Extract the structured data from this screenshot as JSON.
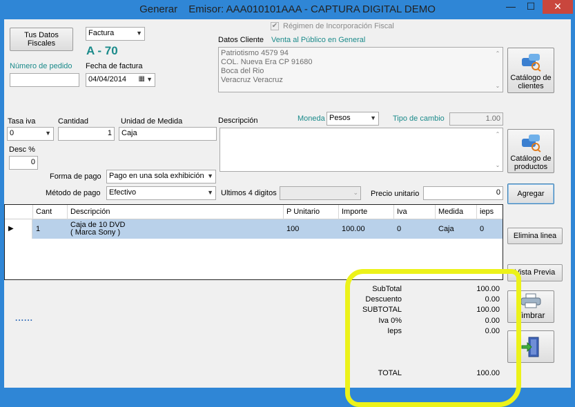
{
  "window": {
    "title": "Generar",
    "emisor": "Emisor: AAA010101AAA  -  CAPTURA DIGITAL DEMO",
    "minimize_glyph": "—",
    "maximize_glyph": "☐",
    "close_glyph": "✕"
  },
  "header": {
    "tus_datos_fiscales": "Tus Datos\nFiscales",
    "doc_type": "Factura",
    "folio": "A - 70",
    "numero_pedido_label": "Número de pedido",
    "numero_pedido_value": "",
    "fecha_factura_label": "Fecha de factura",
    "fecha_factura_value": "04/04/2014",
    "regimen_label": "Régimen de Incorporación Fiscal",
    "regimen_checked": true,
    "datos_cliente_label": "Datos Cliente",
    "cliente_name": "Venta al Público en General",
    "cliente_address": [
      "Patriotismo 4579 94",
      "COL. Nueva Era   CP 91680",
      "Boca del Rio",
      "Veracruz    Veracruz"
    ],
    "catalogo_clientes": "Catálogo de\nclientes"
  },
  "product": {
    "tasa_iva_label": "Tasa iva",
    "tasa_iva_value": "0",
    "cantidad_label": "Cantidad",
    "cantidad_value": "1",
    "unidad_label": "Unidad de Medida",
    "unidad_value": "Caja",
    "descripcion_label": "Descripción",
    "moneda_label": "Moneda",
    "moneda_value": "Pesos",
    "tipo_cambio_label": "Tipo de cambio",
    "tipo_cambio_value": "1.00",
    "desc_label": "Desc %",
    "desc_value": "0",
    "catalogo_productos": "Catálogo de\nproductos",
    "forma_pago_label": "Forma de pago",
    "forma_pago_value": "Pago en una sola exhibición",
    "metodo_pago_label": "Método de pago",
    "metodo_pago_value": "Efectivo",
    "ultimos4_label": "Ultimos 4 digitos",
    "ultimos4_value": "",
    "precio_unitario_label": "Precio unitario",
    "precio_unitario_value": "0",
    "agregar": "Agregar"
  },
  "grid": {
    "columns": [
      "Cant",
      "Descripción",
      "P Unitario",
      "Importe",
      "Iva",
      "Medida",
      "ieps"
    ],
    "rows": [
      {
        "cant": "1",
        "descripcion_1": "Caja de 10 DVD",
        "descripcion_2": "( Marca Sony )",
        "p_unitario": "100",
        "importe": "100.00",
        "iva": "0",
        "medida": "Caja",
        "ieps": "0"
      }
    ]
  },
  "actions": {
    "elimina_linea": "Elimina linea",
    "vista_previa": "Vista Previa",
    "timbrar": "Timbrar",
    "dots": "......"
  },
  "totals": {
    "subtotal_label": "SubTotal",
    "subtotal_value": "100.00",
    "descuento_label": "Descuento",
    "descuento_value": "0.00",
    "subtotal2_label": "SUBTOTAL",
    "subtotal2_value": "100.00",
    "iva_label": "Iva 0%",
    "iva_value": "0.00",
    "ieps_label": "Ieps",
    "ieps_value": "0.00",
    "total_label": "TOTAL",
    "total_value": "100.00"
  },
  "colors": {
    "titlebar": "#2f86d6",
    "close": "#c9463d",
    "selection": "#b9d1ea",
    "teal": "#1a8a8a",
    "highlight": "#ecf21a"
  }
}
